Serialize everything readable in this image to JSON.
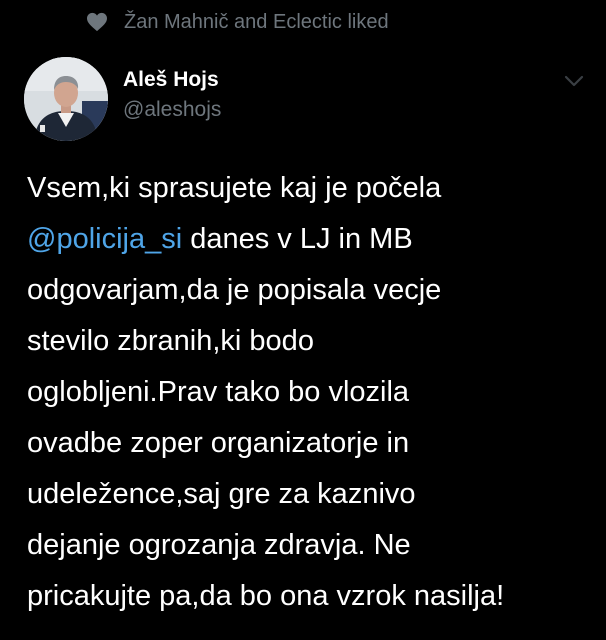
{
  "social_context": {
    "text": "Žan Mahnič and Eclectic liked",
    "icon": "heart-icon"
  },
  "author": {
    "display_name": "Aleš Hojs",
    "handle": "@aleshojs"
  },
  "menu": {
    "icon": "chevron-down-icon"
  },
  "tweet": {
    "line1": "Vsem,ki sprasujete kaj je počela",
    "mention": "@policija_si",
    "line2_rest": " danes v LJ in MB",
    "line3": "odgovarjam,da je popisala vecje",
    "line4": "stevilo zbranih,ki bodo",
    "line5": "oglobljeni.Prav tako bo vlozila",
    "line6": "ovadbe zoper organizatorje in",
    "line7": "udeležence,saj gre za kaznivo",
    "line8": "dejanje ogrozanja zdravja. Ne",
    "line9": "pricakujte pa,da bo ona vzrok nasilja!"
  },
  "colors": {
    "background": "#000000",
    "text_primary": "#ffffff",
    "text_secondary": "#6e767d",
    "mention": "#4fa5e8"
  }
}
